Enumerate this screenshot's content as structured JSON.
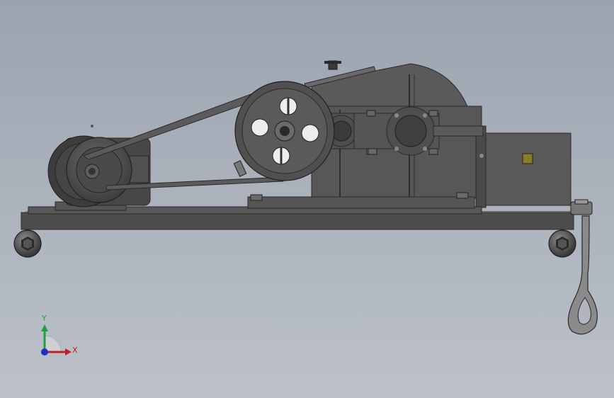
{
  "viewport": {
    "background_top": "#9aa3af",
    "background_bottom": "#bcc1c9"
  },
  "model": {
    "frame_color": "#4d4d4d",
    "frame_edge": "#2a2a2a",
    "housing_color": "#565656",
    "pulley_color": "#4a4a4a",
    "motor_color": "#474747",
    "hook_color": "#8a8a8a",
    "label_plate_color": "#8a7a2a"
  },
  "triad": {
    "x_label": "X",
    "y_label": "Y",
    "x_color": "#c0202a",
    "y_color": "#20a040",
    "z_color": "#2030c0"
  }
}
